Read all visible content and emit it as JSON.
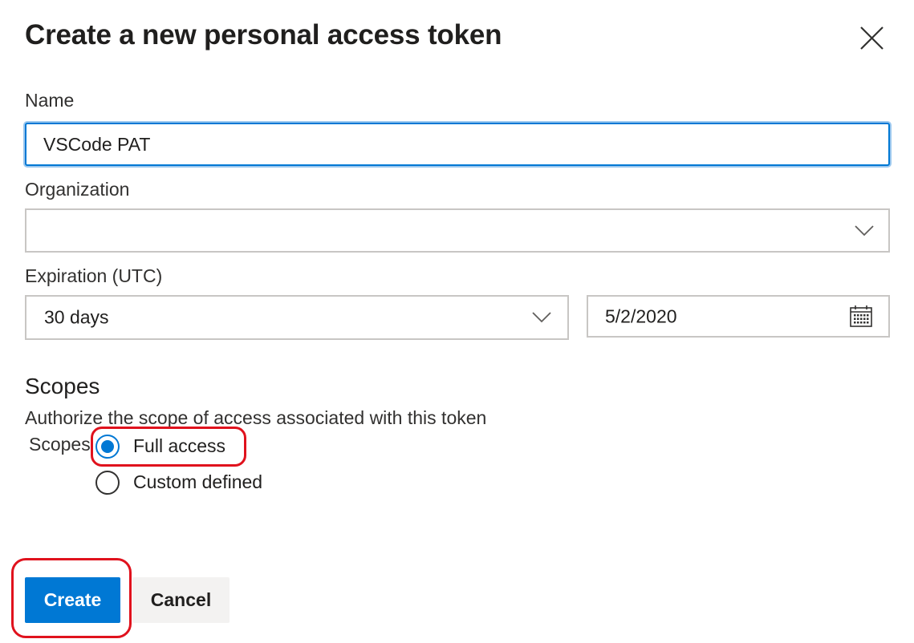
{
  "dialog": {
    "title": "Create a new personal access token"
  },
  "form": {
    "name": {
      "label": "Name",
      "value": "VSCode PAT"
    },
    "organization": {
      "label": "Organization",
      "value": ""
    },
    "expiration": {
      "label": "Expiration (UTC)",
      "duration_value": "30 days",
      "date_value": "5/2/2020"
    }
  },
  "scopes": {
    "title": "Scopes",
    "description": "Authorize the scope of access associated with this token",
    "group_label": "Scopes",
    "options": [
      {
        "label": "Full access",
        "checked": true
      },
      {
        "label": "Custom defined",
        "checked": false
      }
    ]
  },
  "actions": {
    "create_label": "Create",
    "cancel_label": "Cancel"
  },
  "colors": {
    "accent": "#0078d4",
    "highlight": "#e0121d"
  },
  "icons": {
    "close": "close-icon",
    "dropdown": "chevron-down-icon",
    "calendar": "calendar-icon"
  }
}
